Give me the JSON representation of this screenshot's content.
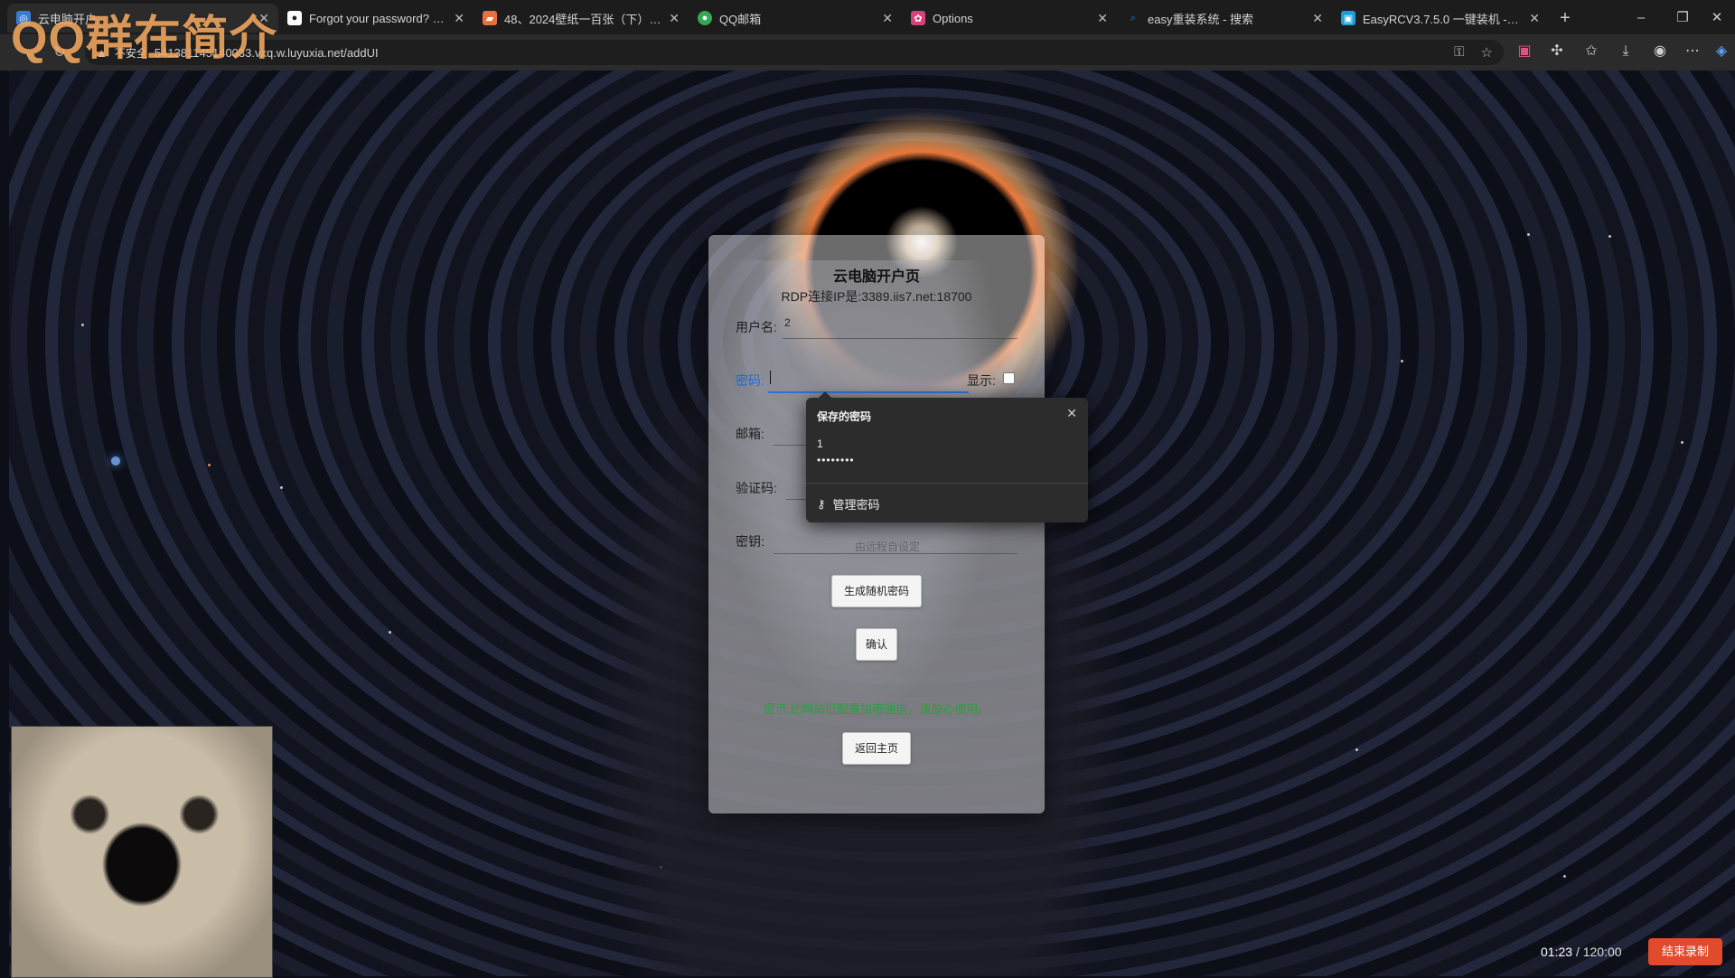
{
  "browser": {
    "tabs": [
      {
        "title": "云电脑开户",
        "icon_color": "#3a7bd5",
        "active": true
      },
      {
        "title": "Forgot your password? · GitHub",
        "icon_color": "#ffffff"
      },
      {
        "title": "48、2024壁纸一百张（下）.rar -",
        "icon_color": "#e8703a"
      },
      {
        "title": "QQ邮箱",
        "icon_color": "#34a853"
      },
      {
        "title": "Options",
        "icon_color": "#d6417a"
      },
      {
        "title": "easy重装系统 - 搜索",
        "icon_color": "#2d7ff9"
      },
      {
        "title": "EasyRCV3.7.5.0 一键装机 - FirPE",
        "icon_color": "#1aa0d8"
      }
    ],
    "address": {
      "secure_label": "不安全",
      "url": "541381145140033.vxq.w.luyuxia.net/addUI"
    }
  },
  "watermark": "QQ群在简介",
  "form": {
    "title": "云电脑开户页",
    "subtitle": "RDP连接IP是:3389.iis7.net:18700",
    "username_label": "用户名:",
    "username_value": "2",
    "password_label": "密码:",
    "show_label": "显示:",
    "email_label": "邮箱:",
    "captcha_label": "验证码:",
    "key_label": "密钥:",
    "key_placeholder": "由远程自设定",
    "generate_button": "生成随机密码",
    "confirm_button": "确认",
    "notice": "提示:此网站已配置加密通信，请放心使用。",
    "back_button": "返回主页"
  },
  "saved_password_popup": {
    "title": "保存的密码",
    "username": "1",
    "password_mask": "••••••••",
    "manage_label": "管理密码"
  },
  "recording": {
    "elapsed": "01:23",
    "total": "/ 120:00",
    "end_button": "结束录制"
  },
  "colors": {
    "accent_blue": "#2d74da",
    "notice_green": "#24a33a",
    "record_red": "#e24a2c",
    "watermark_orange": "#f2a860"
  }
}
